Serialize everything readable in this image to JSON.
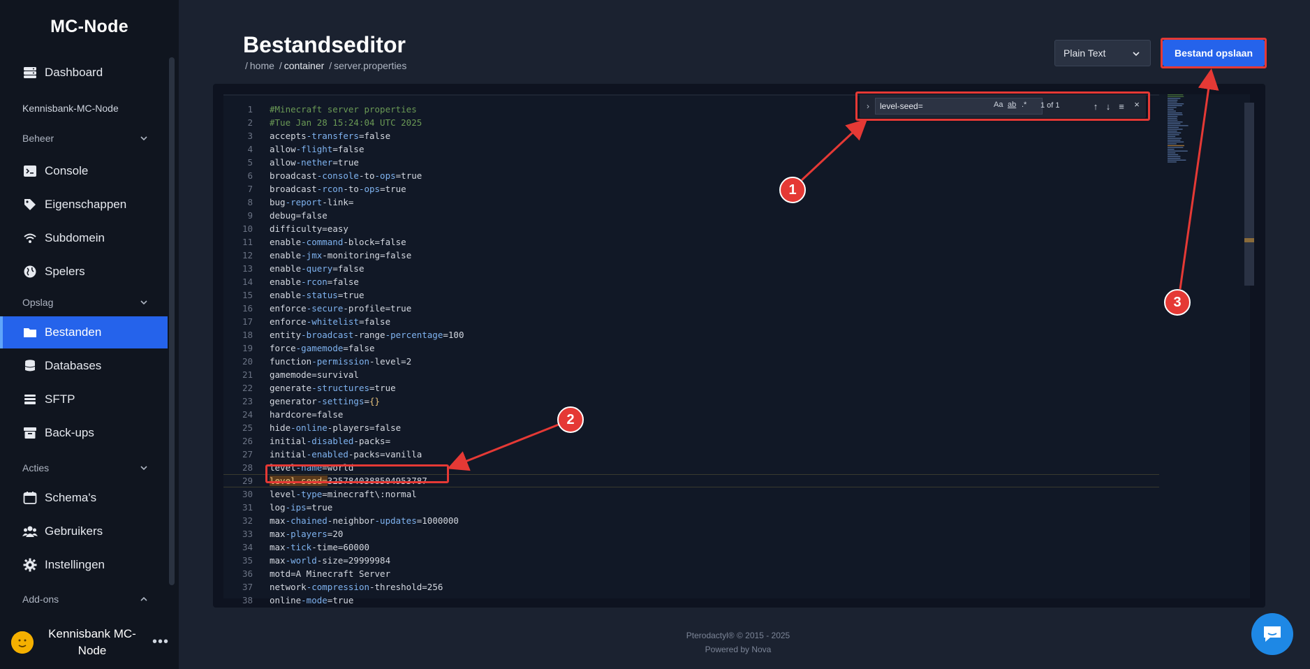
{
  "brand": "MC-Node",
  "sidebar": {
    "dashboard": "Dashboard",
    "org": "Kennisbank-MC-Node",
    "sections": {
      "beheer": "Beheer",
      "opslag": "Opslag",
      "acties": "Acties",
      "addons": "Add-ons"
    },
    "items": {
      "console": "Console",
      "eigenschappen": "Eigenschappen",
      "subdomein": "Subdomein",
      "spelers": "Spelers",
      "bestanden": "Bestanden",
      "databases": "Databases",
      "sftp": "SFTP",
      "backups": "Back-ups",
      "schemas": "Schema's",
      "gebruikers": "Gebruikers",
      "instellingen": "Instellingen"
    },
    "user": {
      "name_line1": "Kennisbank MC-",
      "name_line2": "Node",
      "more": "•••"
    }
  },
  "header": {
    "title": "Bestandseditor",
    "breadcrumb": [
      "home",
      "container",
      "server.properties"
    ],
    "mode": "Plain Text",
    "save_label": "Bestand opslaan"
  },
  "find": {
    "query": "level-seed=",
    "opt_case": "Aa",
    "opt_word": "ab",
    "opt_regex": ".*",
    "count": "1 of 1"
  },
  "annotations": [
    "1",
    "2",
    "3"
  ],
  "footer": {
    "line1": "Pterodactyl® © 2015 - 2025",
    "line2": "Powered by Nova"
  },
  "colors": {
    "accent": "#2563eb",
    "annotation": "#e53935"
  },
  "code": [
    "#Minecraft server properties",
    "#Tue Jan 28 15:24:04 UTC 2025",
    "accepts-transfers=false",
    "allow-flight=false",
    "allow-nether=true",
    "broadcast-console-to-ops=true",
    "broadcast-rcon-to-ops=true",
    "bug-report-link=",
    "debug=false",
    "difficulty=easy",
    "enable-command-block=false",
    "enable-jmx-monitoring=false",
    "enable-query=false",
    "enable-rcon=false",
    "enable-status=true",
    "enforce-secure-profile=true",
    "enforce-whitelist=false",
    "entity-broadcast-range-percentage=100",
    "force-gamemode=false",
    "function-permission-level=2",
    "gamemode=survival",
    "generate-structures=true",
    "generator-settings={}",
    "hardcore=false",
    "hide-online-players=false",
    "initial-disabled-packs=",
    "initial-enabled-packs=vanilla",
    "level-name=world",
    "level-seed=3257840388504953787",
    "level-type=minecraft\\:normal",
    "log-ips=true",
    "max-chained-neighbor-updates=1000000",
    "max-players=20",
    "max-tick-time=60000",
    "max-world-size=29999984",
    "motd=A Minecraft Server",
    "network-compression-threshold=256",
    "online-mode=true"
  ]
}
